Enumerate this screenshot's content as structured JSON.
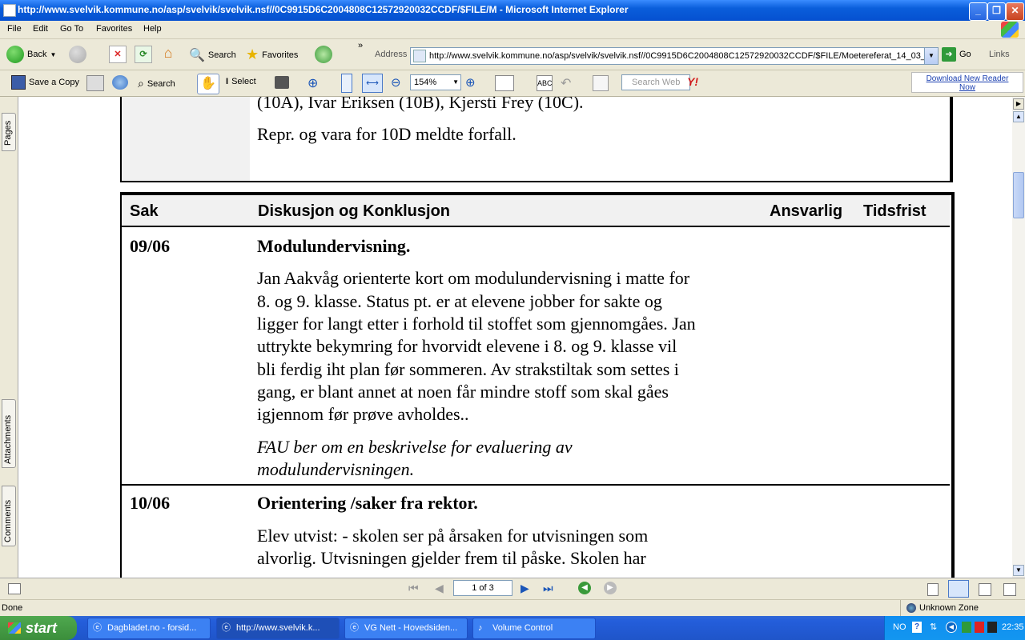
{
  "window": {
    "title": "http://www.svelvik.kommune.no/asp/svelvik/svelvik.nsf//0C9915D6C2004808C12572920032CCDF/$FILE/M - Microsoft Internet Explorer"
  },
  "menu": [
    "File",
    "Edit",
    "Go To",
    "Favorites",
    "Help"
  ],
  "toolbar": {
    "back": "Back",
    "search": "Search",
    "favorites": "Favorites",
    "address_label": "Address",
    "go": "Go",
    "links": "Links"
  },
  "address": {
    "value": "http://www.svelvik.kommune.no/asp/svelvik/svelvik.nsf//0C9915D6C2004808C12572920032CCDF/$FILE/Moetereferat_14_03_"
  },
  "reader": {
    "save_copy": "Save a Copy",
    "search": "Search",
    "select": "Select",
    "zoom": "154%",
    "search_web_placeholder": "Search Web",
    "download_line1": "Download New Reader",
    "download_line2": "Now"
  },
  "sidepanel": {
    "pages": "Pages",
    "attachments": "Attachments",
    "comments": "Comments"
  },
  "document": {
    "top_lines": [
      "(10A), Ivar Eriksen (10B), Kjersti Frey (10C).",
      "Repr. og vara for 10D meldte forfall."
    ],
    "headers": {
      "sak": "Sak",
      "diskusjon": "Diskusjon og Konklusjon",
      "ansvarlig": "Ansvarlig",
      "tidsfrist": "Tidsfrist"
    },
    "item1": {
      "num": "09/06",
      "title": "Modulundervisning.",
      "body": [
        "Jan Aakvåg orienterte kort om modulundervisning i matte for",
        "8. og 9. klasse.  Status pt. er at elevene jobber for sakte og",
        "ligger for langt etter i forhold til stoffet som gjennomgåes. Jan",
        "uttrykte bekymring for hvorvidt elevene i 8. og 9. klasse vil",
        "bli ferdig iht plan før sommeren.  Av strakstiltak som settes i",
        "gang, er blant annet at noen får mindre stoff som skal gåes",
        "igjennom før prøve avholdes.."
      ],
      "conclusion": [
        "FAU ber om en beskrivelse for evaluering av",
        "modulundervisningen."
      ]
    },
    "item2": {
      "num": "10/06",
      "title": "Orientering /saker fra rektor.",
      "body": [
        "Elev utvist: - skolen ser på årsaken for utvisningen som",
        "alvorlig.  Utvisningen gjelder frem til påske.  Skolen har"
      ]
    }
  },
  "nav": {
    "page_indicator": "1 of 3"
  },
  "status": {
    "left": "Done",
    "zone": "Unknown Zone"
  },
  "taskbar": {
    "start": "start",
    "tasks": [
      "Dagbladet.no - forsid...",
      "http://www.svelvik.k...",
      "VG Nett - Hovedsiden...",
      "Volume Control"
    ],
    "lang": "NO",
    "clock": "22:35"
  }
}
